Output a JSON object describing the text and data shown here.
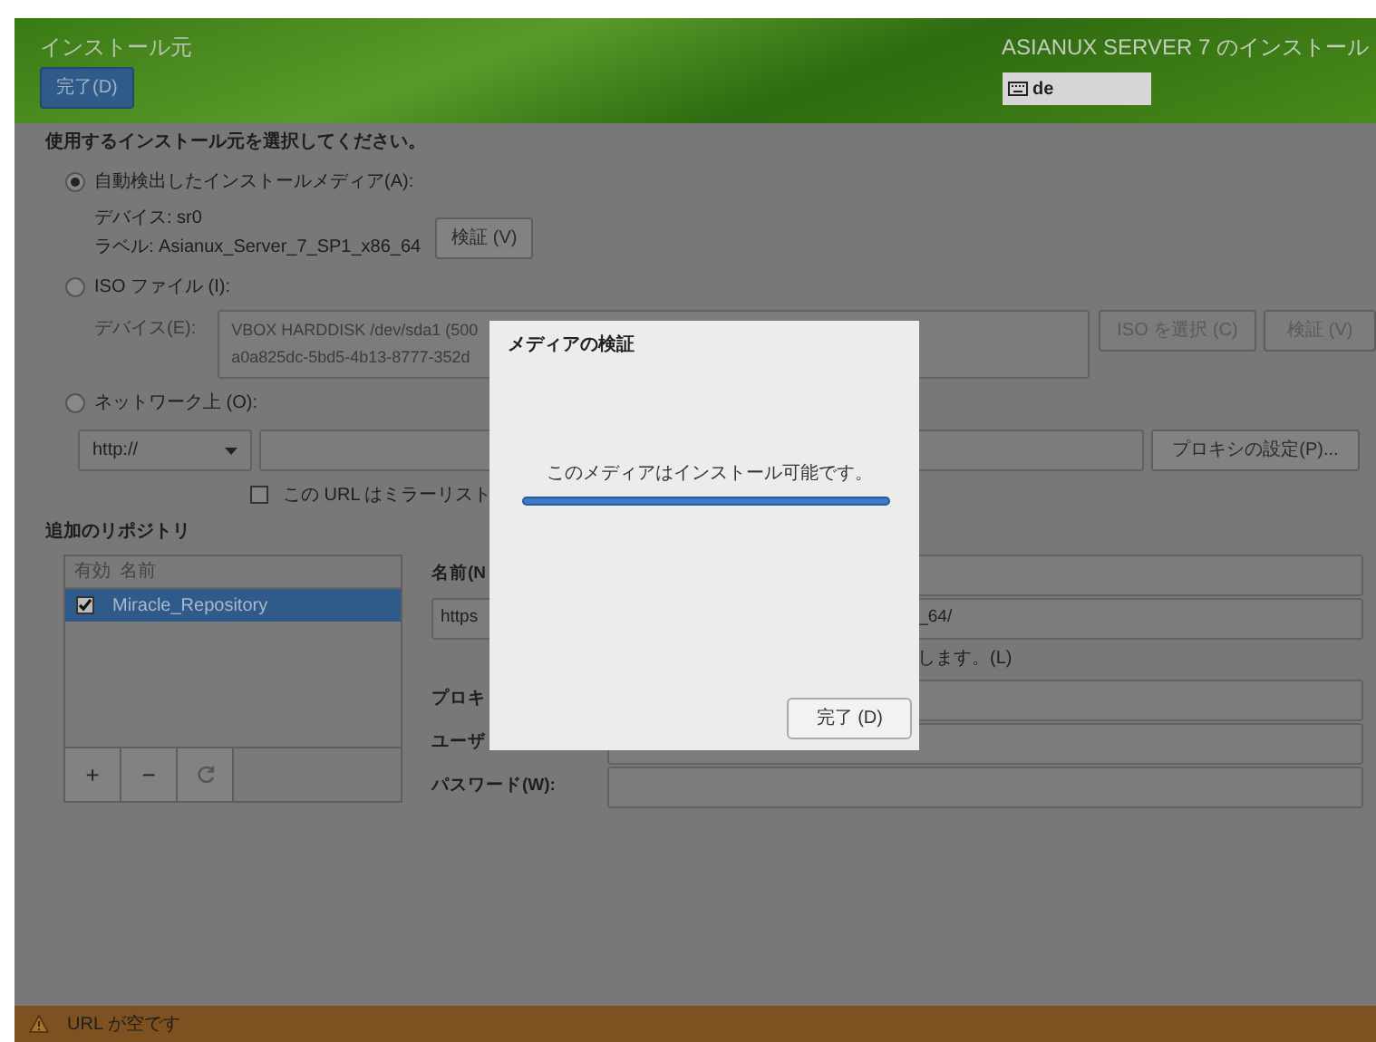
{
  "header": {
    "title": "インストール元",
    "done_button": "完了(D)",
    "product": "ASIANUX SERVER 7 のインストール",
    "keyboard_layout": "de"
  },
  "prompt": "使用するインストール元を選択してください。",
  "sources": [
    {
      "kind": "media",
      "label": "自動検出したインストールメディア(A):",
      "selected": true,
      "device": "デバイス: sr0",
      "volume_label": "ラベル: Asianux_Server_7_SP1_x86_64",
      "verify_button": "検証 (V)"
    },
    {
      "kind": "iso",
      "label": "ISO ファイル (I):",
      "selected": false,
      "disabled": true,
      "device_label": "デバイス(E):",
      "device_lines": [
        "VBOX HARDDISK /dev/sda1 (500",
        "a0a825dc-5bd5-4b13-8777-352d"
      ],
      "choose_button": "ISO を選択 (C)",
      "verify_button": "検証 (V)"
    },
    {
      "kind": "network",
      "label": "ネットワーク上 (O):",
      "selected": false,
      "protocol": "http://",
      "proxy_button": "プロキシの設定(P)...",
      "mirror_checkbox": {
        "label": "この URL はミラーリスト",
        "checked": false
      }
    }
  ],
  "repositories": {
    "title": "追加のリポジトリ",
    "columns": [
      "有効",
      "名前"
    ],
    "rows": [
      {
        "enabled": true,
        "name": "Miracle_Repository",
        "selected": true
      }
    ],
    "toolbar": [
      "+",
      "−"
    ]
  },
  "repo_form": {
    "name_label": "名前(N",
    "url_start": "https",
    "url_end": "_64/",
    "mirror_note": "します。(L)",
    "proxy_label": "プロキ",
    "user_label": "ユーザ",
    "password_label": "パスワード(W):"
  },
  "dialog": {
    "title": "メディアの検証",
    "message": "このメディアはインストール可能です。",
    "progress": {
      "level": 1
    },
    "done_button": "完了 (D)"
  },
  "status_bar": {
    "kind": "warning",
    "message": "URL が空です"
  }
}
